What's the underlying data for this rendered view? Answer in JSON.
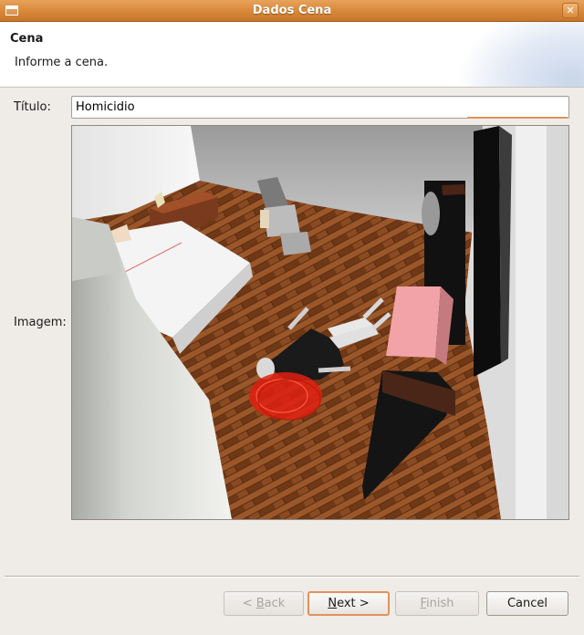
{
  "window": {
    "title": "Dados Cena"
  },
  "header": {
    "title": "Cena",
    "description": "Informe a cena."
  },
  "form": {
    "titulo_label": "Título:",
    "titulo_value": "Homicidio",
    "imagem_label": "Imagem:",
    "image_description_icon": "crime-scene-3d-render"
  },
  "buttons": {
    "back": {
      "mnemonic": "B",
      "rest": "ack",
      "prefix": "< ",
      "enabled": false
    },
    "next": {
      "mnemonic": "N",
      "rest": "ext >",
      "enabled": true
    },
    "finish": {
      "mnemonic": "F",
      "rest": "inish",
      "enabled": false
    },
    "cancel": {
      "label": "Cancel",
      "enabled": true
    }
  },
  "colors": {
    "titlebar": "#d98a3a",
    "focus_accent": "#e0935a",
    "blood": "#e02010",
    "floor": "#8a4a22"
  }
}
